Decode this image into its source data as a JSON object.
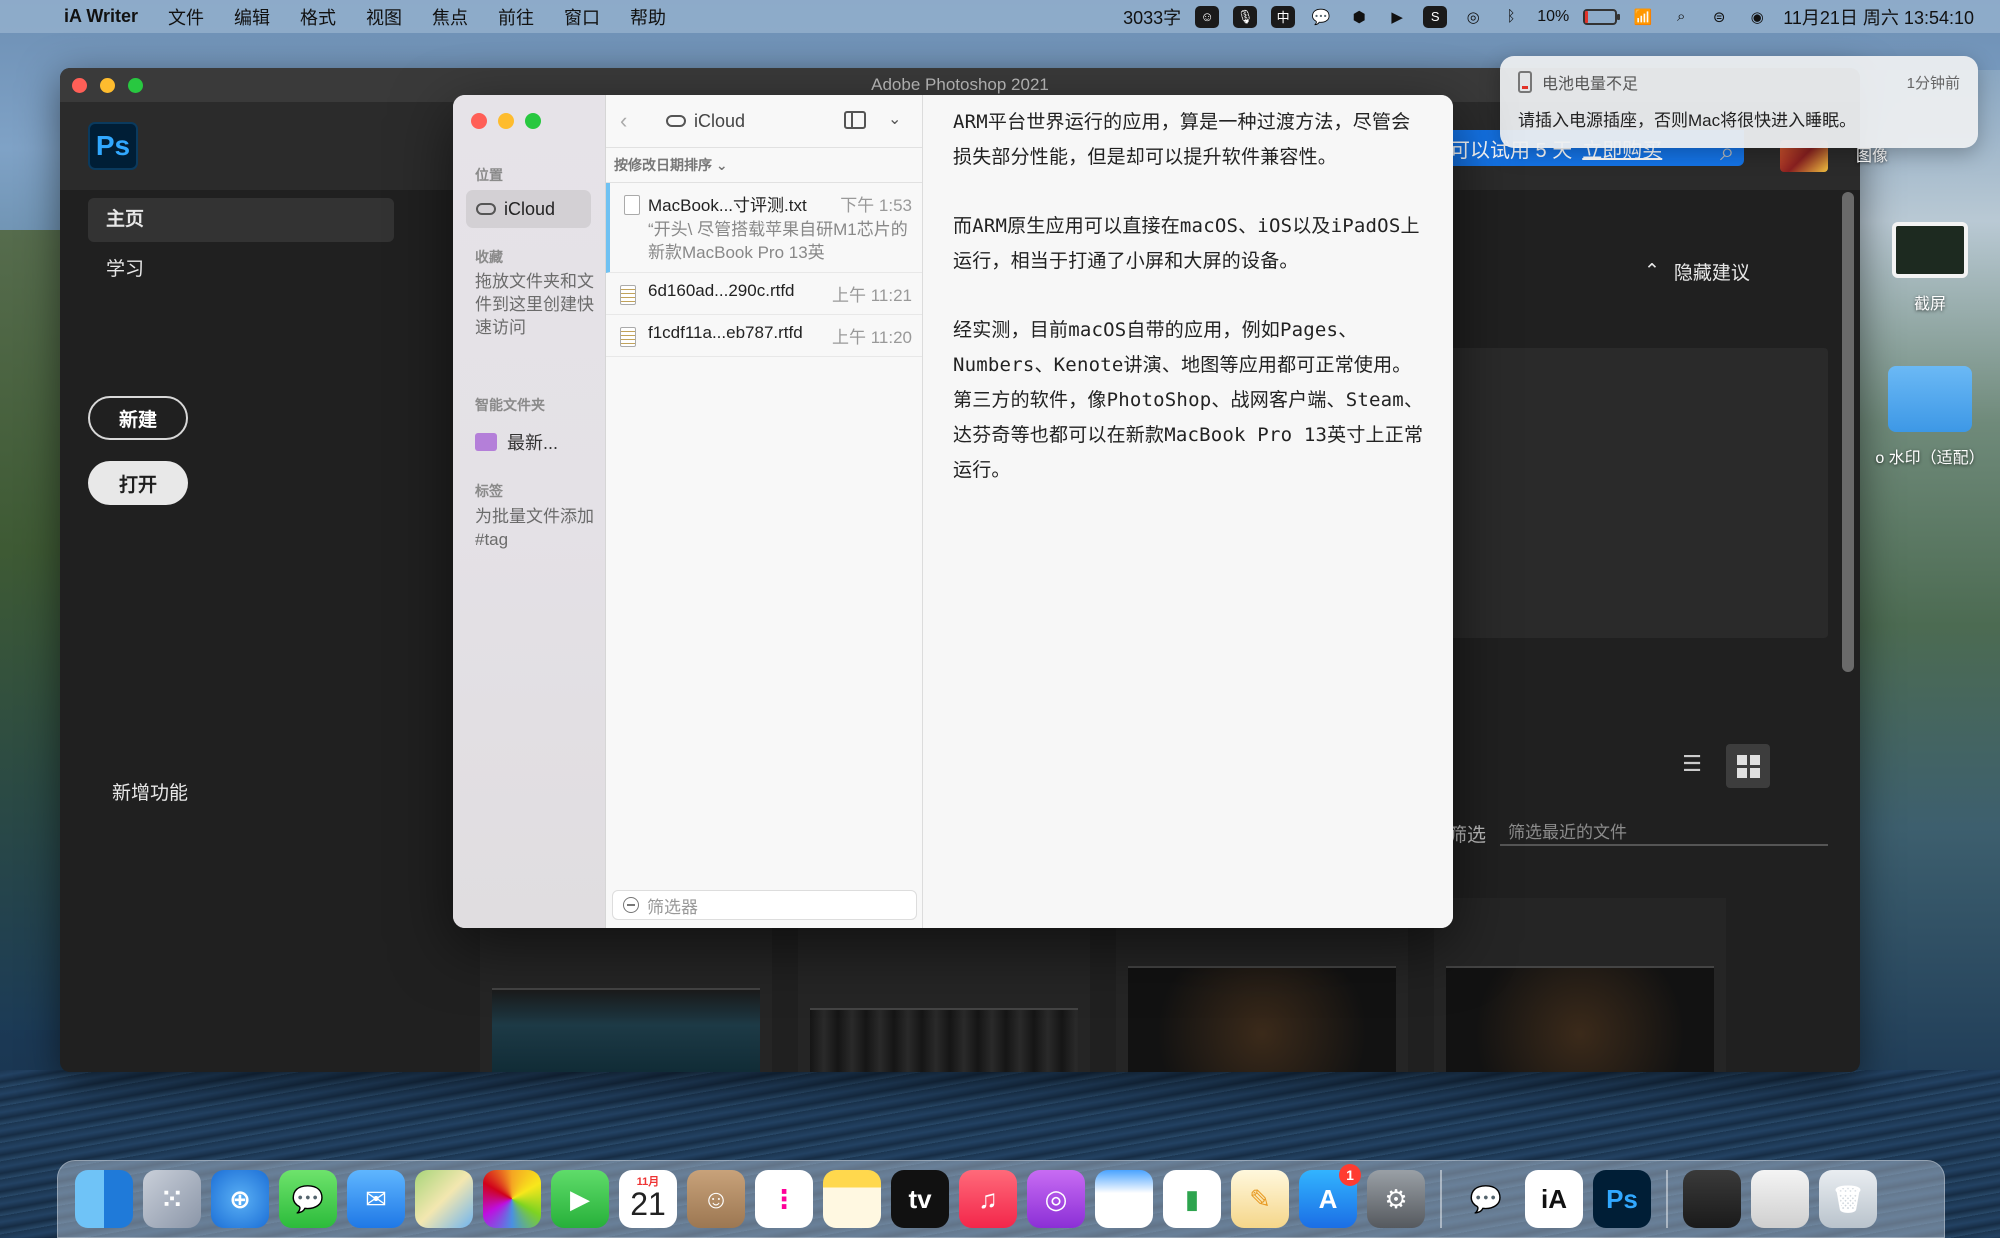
{
  "menubar": {
    "app_name": "iA Writer",
    "menus": [
      "文件",
      "编辑",
      "格式",
      "视图",
      "焦点",
      "前往",
      "窗口",
      "帮助"
    ],
    "word_count": "3033字",
    "battery_percent": "10%",
    "battery_level": 0.1,
    "datetime": "11月21日 周六  13:54:10"
  },
  "notification": {
    "title": "电池电量不足",
    "time": "1分钟前",
    "body": "请插入电源插座，否则Mac将很快进入睡眠。"
  },
  "photoshop": {
    "window_title": "Adobe Photoshop 2021",
    "logo": "Ps",
    "nav": [
      "主页",
      "学习"
    ],
    "new_button": "新建",
    "open_button": "打开",
    "new_features": "新增功能",
    "trial_text": "可以试用 5 天",
    "trial_link": "立即购买",
    "hide_tips": "隐藏建议",
    "filter_label": "筛选",
    "filter_placeholder": "筛选最近的文件"
  },
  "desktop": {
    "partial_label": "图像",
    "screenshot_label": "截屏",
    "folder_label": "o 水印（适配）"
  },
  "iawriter": {
    "sidebar": {
      "location_section": "位置",
      "location_item": "iCloud",
      "favorites_section": "收藏",
      "favorites_hint": "拖放文件夹和文件到这里创建快速访问",
      "smart_section": "智能文件夹",
      "smart_item": "最新...",
      "tags_section": "标签",
      "tags_hint": "为批量文件添加#tag"
    },
    "list": {
      "folder_name": "iCloud",
      "sort_label": "按修改日期排序 ⌄",
      "filter_placeholder": "筛选器",
      "files": [
        {
          "name": "MacBook...寸评测.txt",
          "time": "下午 1:53",
          "preview": "“开头\\ 尽管搭载苹果自研M1芯片的新款MacBook Pro 13英"
        },
        {
          "name": "6d160ad...290c.rtfd",
          "time": "上午 11:21",
          "preview": ""
        },
        {
          "name": "f1cdf11a...eb787.rtfd",
          "time": "上午 11:20",
          "preview": ""
        }
      ]
    },
    "editor": {
      "paragraphs": [
        "ARM平台世界运行的应用，算是一种过渡方法，尽管会损失部分性能，但是却可以提升软件兼容性。",
        "而ARM原生应用可以直接在macOS、iOS以及iPadOS上运行，相当于打通了小屏和大屏的设备。",
        "经实测，目前macOS自带的应用，例如Pages、Numbers、Kenote讲演、地图等应用都可正常使用。第三方的软件，像PhotoShop、战网客户端、Steam、达芬奇等也都可以在新款MacBook Pro 13英寸上正常运行。"
      ]
    }
  },
  "dock": {
    "calendar_month": "11月",
    "calendar_day": "21",
    "tv_label": "tv",
    "appstore_badge": "1",
    "ia_label": "iA",
    "ps_label": "Ps"
  }
}
